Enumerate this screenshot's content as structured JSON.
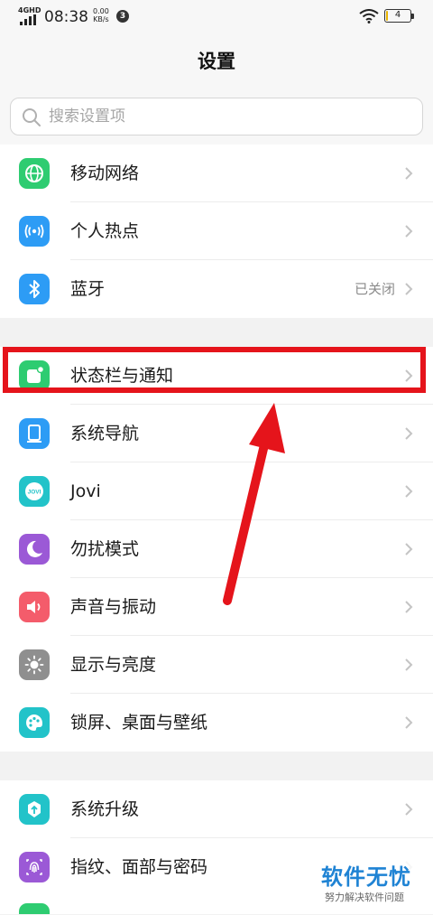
{
  "status_bar": {
    "network": "4GHD",
    "time": "08:38",
    "speed_value": "0.00",
    "speed_unit": "KB/s",
    "notification_count": "3",
    "battery": "4"
  },
  "header": {
    "title": "设置"
  },
  "search": {
    "placeholder": "搜索设置项"
  },
  "groups": [
    {
      "items": [
        {
          "label": "移动网络",
          "icon": "globe-icon",
          "color": "#2ecc71"
        },
        {
          "label": "个人热点",
          "icon": "hotspot-icon",
          "color": "#2d9cf5"
        },
        {
          "label": "蓝牙",
          "icon": "bluetooth-icon",
          "color": "#2d9cf5",
          "value": "已关闭"
        }
      ]
    },
    {
      "items": [
        {
          "label": "状态栏与通知",
          "icon": "notification-icon",
          "color": "#2ecc71"
        },
        {
          "label": "系统导航",
          "icon": "navigation-icon",
          "color": "#2d9cf5"
        },
        {
          "label": "Jovi",
          "icon": "jovi-icon",
          "color": "#22c3c9"
        },
        {
          "label": "勿扰模式",
          "icon": "moon-icon",
          "color": "#9b59d6"
        },
        {
          "label": "声音与振动",
          "icon": "speaker-icon",
          "color": "#f45c6b"
        },
        {
          "label": "显示与亮度",
          "icon": "brightness-icon",
          "color": "#8f8f8f"
        },
        {
          "label": "锁屏、桌面与壁纸",
          "icon": "palette-icon",
          "color": "#22c3c9"
        }
      ]
    },
    {
      "items": [
        {
          "label": "系统升级",
          "icon": "upgrade-icon",
          "color": "#22c3c9"
        },
        {
          "label": "指纹、面部与密码",
          "icon": "fingerprint-icon",
          "color": "#9b59d6"
        }
      ]
    }
  ],
  "watermark": {
    "title": "软件无忧",
    "subtitle": "努力解决软件问题"
  }
}
